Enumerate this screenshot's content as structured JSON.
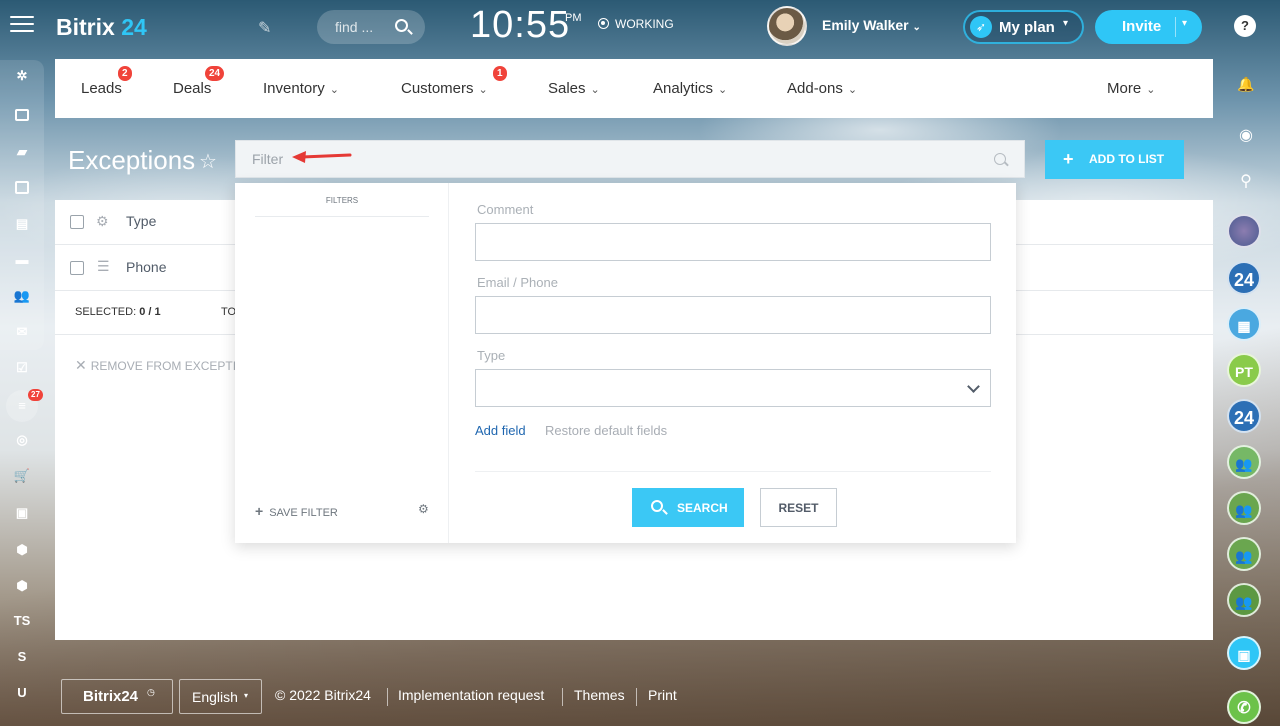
{
  "header": {
    "logo_text": "Bitrix",
    "logo_num": "24",
    "search_placeholder": "find ...",
    "clock_time": "10:55",
    "clock_ampm": "PM",
    "status": "WORKING",
    "user_name": "Emily Walker",
    "myplan_label": "My plan",
    "invite_label": "Invite"
  },
  "nav": {
    "items": [
      {
        "label": "Leads",
        "badge": "2"
      },
      {
        "label": "Deals",
        "badge": "24"
      },
      {
        "label": "Inventory"
      },
      {
        "label": "Customers",
        "badge": "1"
      },
      {
        "label": "Sales"
      },
      {
        "label": "Analytics"
      },
      {
        "label": "Add-ons"
      },
      {
        "label": "More"
      }
    ]
  },
  "leftbar": {
    "filter_badge": "27",
    "text_items": [
      "TS",
      "S",
      "U"
    ]
  },
  "page": {
    "title": "Exceptions",
    "filter_placeholder": "Filter",
    "add_to_list": "ADD TO LIST",
    "columns": [
      "Type",
      "Phone"
    ],
    "selected_label": "SELECTED:",
    "selected_value": "0 / 1",
    "total_prefix": "TO",
    "remove_label": "REMOVE FROM EXCEPTIO"
  },
  "filter_popup": {
    "filters_header": "FILTERS",
    "save_filter": "SAVE FILTER",
    "fields": [
      {
        "label": "Comment",
        "value": ""
      },
      {
        "label": "Email / Phone",
        "value": ""
      },
      {
        "label": "Type",
        "value": ""
      }
    ],
    "add_field": "Add field",
    "restore_defaults": "Restore default fields",
    "search_btn": "SEARCH",
    "reset_btn": "RESET"
  },
  "rightbar": {
    "help": "?",
    "avatars": [
      "24",
      "PT",
      "24"
    ]
  },
  "footer": {
    "logo": "Bitrix24",
    "language": "English",
    "copyright": "© 2022 Bitrix24",
    "implementation": "Implementation request",
    "themes": "Themes",
    "print": "Print"
  },
  "colors": {
    "accent": "#2fc6f6",
    "badge": "#f0433a",
    "link": "#2067b0"
  }
}
